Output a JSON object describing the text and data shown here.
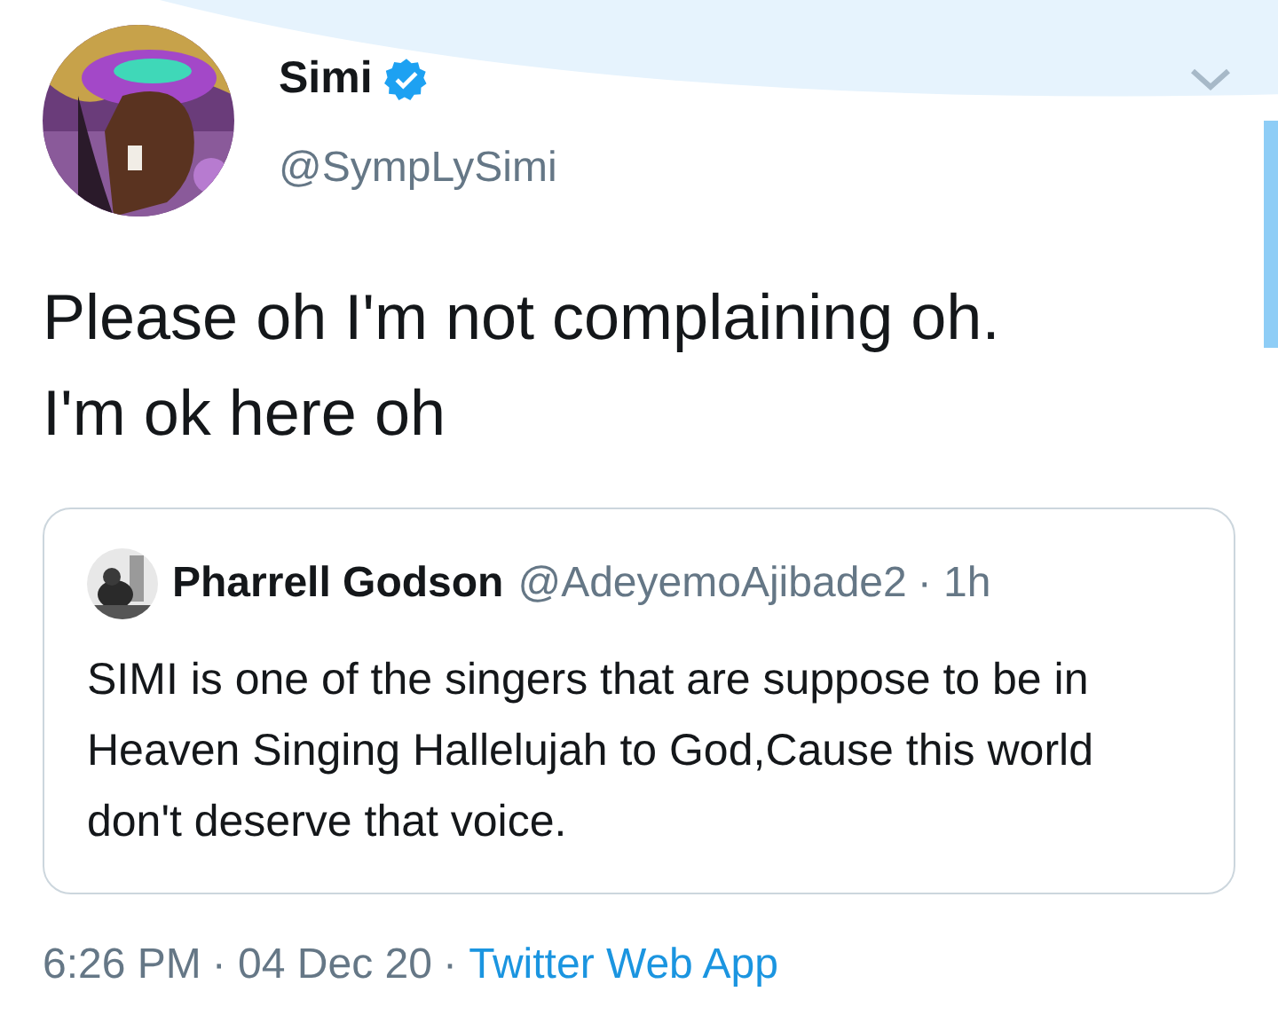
{
  "author": {
    "name": "Simi",
    "verified": true,
    "handle": "@SympLySimi"
  },
  "tweet_text": "Please oh I'm not complaining oh. I'm ok here oh",
  "quoted_tweet": {
    "name": "Pharrell Godson",
    "handle": "@AdeyemoAjibade2",
    "time": "· 1h",
    "text": "SIMI is one of the singers that are suppose to be in Heaven Singing Hallelujah to God,Cause this world don't deserve that voice."
  },
  "footer": {
    "time": "6:26 PM",
    "date": "· 04 Dec 20",
    "source": "· ",
    "client": "Twitter Web App"
  }
}
